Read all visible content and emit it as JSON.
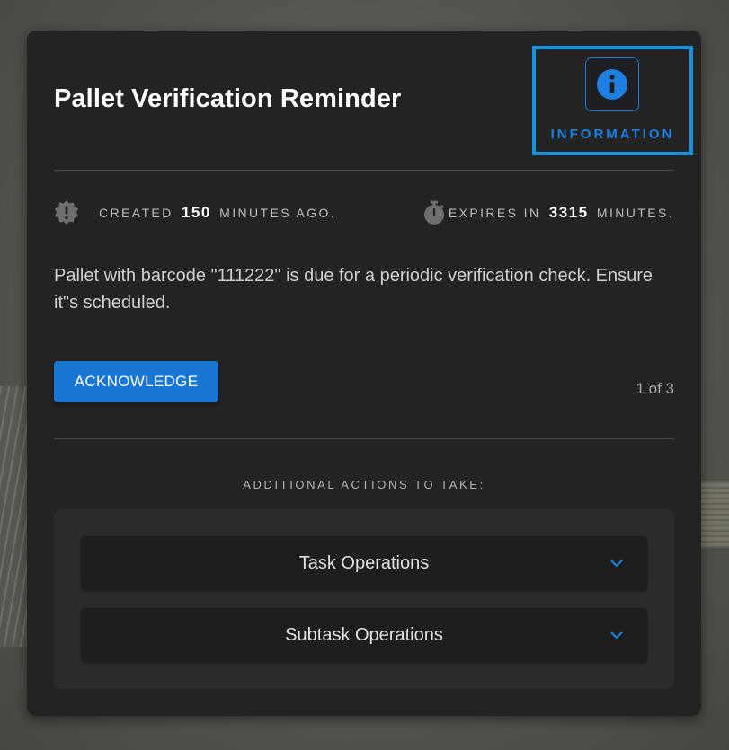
{
  "notification": {
    "title": "Pallet Verification Reminder",
    "type_label": "INFORMATION",
    "created_prefix": "CREATED",
    "created_value": "150",
    "created_suffix": "MINUTES AGO.",
    "expires_prefix": "EXPIRES IN",
    "expires_value": "3315",
    "expires_suffix": "MINUTES.",
    "message": "Pallet with barcode \"111222\" is due for a periodic verification check. Ensure it\"s scheduled.",
    "acknowledge_label": "ACKNOWLEDGE",
    "pager": "1 of 3"
  },
  "additional_actions": {
    "heading": "ADDITIONAL ACTIONS TO TAKE:",
    "sections": [
      {
        "label": "Task Operations"
      },
      {
        "label": "Subtask Operations"
      }
    ]
  },
  "colors": {
    "card_background": "#232323",
    "accent_blue": "#1976d2",
    "badge_highlight_border": "#1593dd",
    "panel_background": "#2b2b2b",
    "accordion_background": "#1e1e1e"
  },
  "icons": {
    "type_icon": "info-circle-icon",
    "created_icon": "alert-gear-icon",
    "expires_icon": "stopwatch-icon",
    "accordion_icon": "chevron-down-icon"
  }
}
